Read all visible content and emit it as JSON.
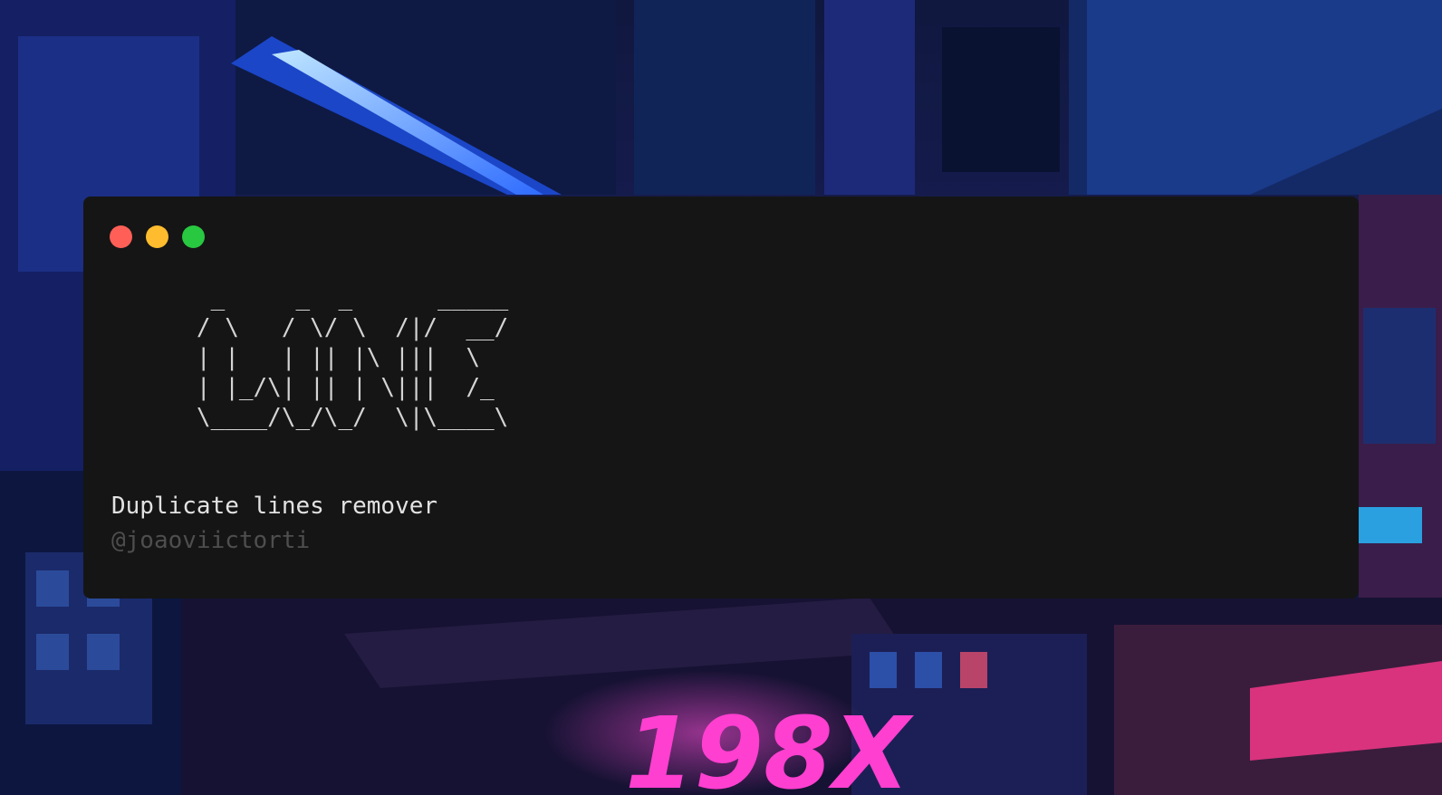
{
  "theme": {
    "window_bg": "#151515",
    "close_color": "#ff5f57",
    "minimize_color": "#febc2e",
    "maximize_color": "#28c840",
    "text_color": "#d4d4d4",
    "muted_text_color": "#4e4e4e"
  },
  "window": {
    "buttons": [
      {
        "name": "close",
        "icon": "circle-icon"
      },
      {
        "name": "minimize",
        "icon": "circle-icon"
      },
      {
        "name": "maximize",
        "icon": "circle-icon"
      }
    ],
    "ascii_logo": "       _     _  _      _____\n      / \\   / \\/ \\  /|/  __/\n      | |   | || |\\ |||  \\  \n      | |_/\\| || | \\|||  /_ \n      \\____/\\_/\\_/  \\|\\____\\",
    "subtitle": "Duplicate lines remover",
    "author": "@joaoviictorti"
  },
  "background": {
    "sign_text": "198X"
  }
}
